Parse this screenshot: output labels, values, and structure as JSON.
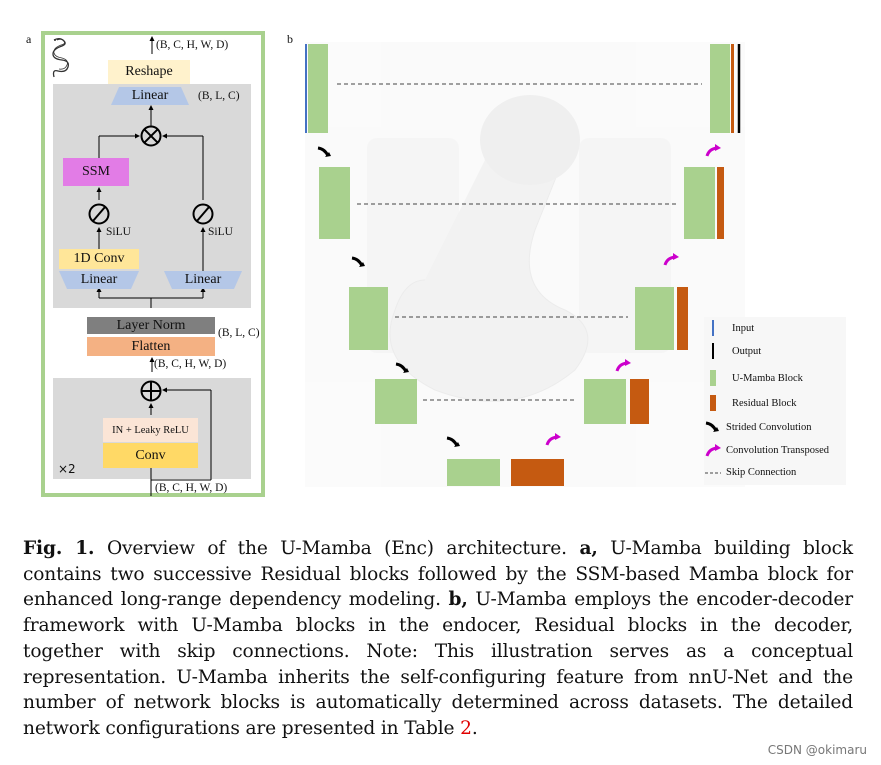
{
  "panel_a": {
    "label": "a",
    "shape_top": "(B, C, H, W, D)",
    "reshape": "Reshape",
    "linear_top": "Linear",
    "shape_blc_top": "(B, L, C)",
    "multiply_symbol": "⊗",
    "ssm": "SSM",
    "silu_left": "SiLU",
    "silu_right": "SiLU",
    "conv1d": "1D Conv",
    "linear_left": "Linear",
    "linear_right": "Linear",
    "layer_norm": "Layer Norm",
    "shape_blc_mid": "(B, L, C)",
    "flatten": "Flatten",
    "shape_mid": "(B, C, H, W, D)",
    "add_symbol": "⊕",
    "in_leaky_relu": "IN + Leaky ReLU",
    "conv": "Conv",
    "repeat": "×2",
    "shape_bottom": "(B, C, H, W, D)"
  },
  "panel_b": {
    "label": "b",
    "legend": [
      {
        "icon": "input-line-icon",
        "label": "Input",
        "color": "#4472c4"
      },
      {
        "icon": "output-line-icon",
        "label": "Output",
        "color": "#000000"
      },
      {
        "icon": "u-mamba-block-swatch",
        "label": "U-Mamba Block",
        "color": "#a9d18e"
      },
      {
        "icon": "residual-block-swatch",
        "label": "Residual Block",
        "color": "#c55a11"
      },
      {
        "icon": "strided-conv-arrow-icon",
        "label": "Strided Convolution",
        "color": "#000000"
      },
      {
        "icon": "conv-transposed-arrow-icon",
        "label": "Convolution Transposed",
        "color": "#cc00cc"
      },
      {
        "icon": "skip-connection-dash-icon",
        "label": "Skip Connection",
        "color": "#444444"
      }
    ],
    "encoder_levels": 5,
    "decoder_levels": 4
  },
  "caption": {
    "fig_label": "Fig. 1.",
    "text1": " Overview of the U-Mamba (Enc) architecture. ",
    "a_label": "a,",
    "text2": " U-Mamba building block contains two successive Residual blocks followed by the SSM-based Mamba block for enhanced long-range dependency modeling. ",
    "b_label": "b,",
    "text3": " U-Mamba employs the encoder-decoder framework with U-Mamba blocks in the endocer, Residual blocks in the decoder, together with skip connections. Note: This illustration serves as a conceptual representation. U-Mamba inherits the self-configuring feature from nnU-Net and the number of network blocks is automatically determined across datasets. The detailed network configurations are presented in Table ",
    "table_ref": "2",
    "text4": "."
  },
  "watermark": "CSDN @okimaru",
  "colors": {
    "green_border": "#a9d18e",
    "gray_panel": "#d9d9d9",
    "reshape": "#fff2cc",
    "linear": "#b4c7e7",
    "ssm": "#e27ce6",
    "conv1d": "#ffe699",
    "layer_norm": "#7f7f7f",
    "flatten": "#f4b183",
    "in_relu": "#fbe5d6",
    "conv": "#ffd966"
  }
}
